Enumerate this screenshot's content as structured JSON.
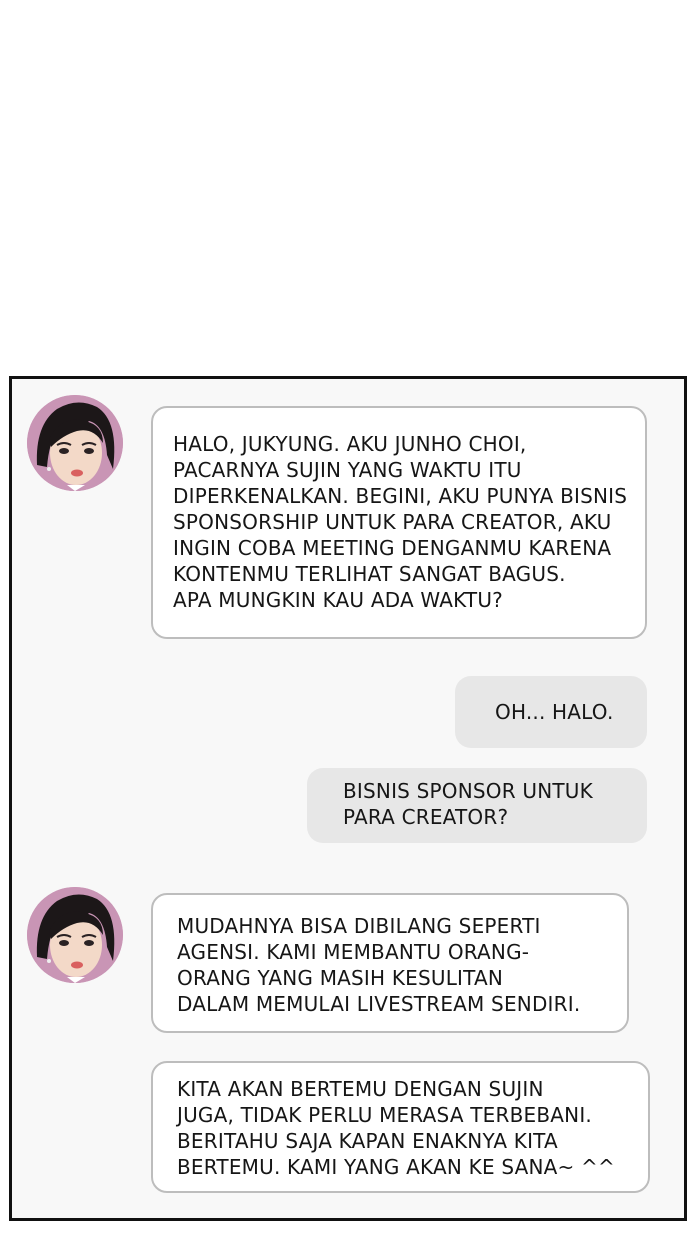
{
  "messages": [
    {
      "side": "incoming",
      "lines": [
        "HALO, JUKYUNG. AKU JUNHO CHOI,",
        "PACARNYA SUJIN YANG WAKTU ITU",
        "DIPERKENALKAN. BEGINI, AKU PUNYA BISNIS",
        "SPONSORSHIP UNTUK PARA CREATOR, AKU",
        "INGIN COBA MEETING DENGANMU KARENA",
        "KONTENMU TERLIHAT SANGAT BAGUS.",
        "APA MUNGKIN KAU ADA WAKTU?"
      ]
    },
    {
      "side": "outgoing",
      "lines": [
        "OH... HALO."
      ]
    },
    {
      "side": "outgoing",
      "lines": [
        "BISNIS SPONSOR UNTUK",
        "PARA CREATOR?"
      ]
    },
    {
      "side": "incoming",
      "lines": [
        "MUDAHNYA BISA DIBILANG SEPERTI",
        "AGENSI. KAMI MEMBANTU ORANG-",
        "ORANG YANG MASIH KESULITAN",
        "DALAM MEMULAI LIVESTREAM SENDIRI."
      ]
    },
    {
      "side": "incoming",
      "lines": [
        "KITA AKAN BERTEMU DENGAN SUJIN",
        "JUGA, TIDAK PERLU MERASA TERBEBANI.",
        "BERITAHU SAJA KAPAN ENAKNYA KITA",
        "BERTEMU. KAMI YANG AKAN KE SANA~ ^^"
      ]
    }
  ],
  "avatar_icon": "person-avatar-icon",
  "colors": {
    "panel_bg": "#f8f8f8",
    "incoming_bubble_bg": "#ffffff",
    "incoming_bubble_border": "#bdbdbd",
    "outgoing_bubble_bg": "#e7e7e7",
    "avatar_bg": "#c995b5",
    "text": "#161616"
  }
}
